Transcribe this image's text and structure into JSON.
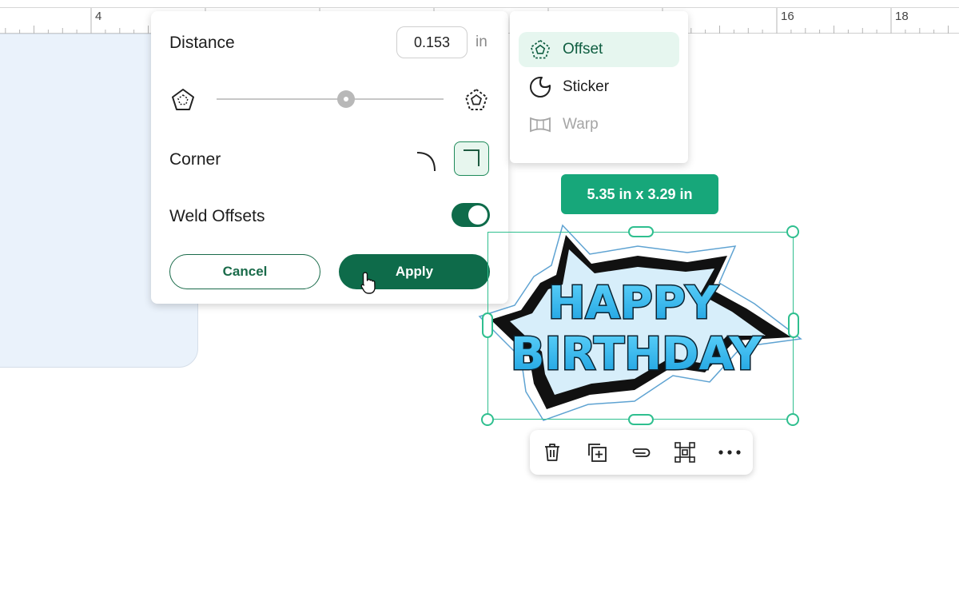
{
  "ruler": {
    "labels": [
      "4",
      "16",
      "18"
    ]
  },
  "offset_panel": {
    "distance_label": "Distance",
    "distance_value": "0.153",
    "distance_unit": "in",
    "slider_level_percent": 57,
    "corner_label": "Corner",
    "corner_selected": "square",
    "weld_label": "Weld Offsets",
    "weld_enabled": true,
    "cancel_label": "Cancel",
    "apply_label": "Apply"
  },
  "menu": {
    "items": [
      {
        "label": "Offset",
        "icon": "offset-icon",
        "selected": true
      },
      {
        "label": "Sticker",
        "icon": "sticker-icon",
        "selected": false
      },
      {
        "label": "Warp",
        "icon": "warp-icon",
        "disabled": true
      }
    ]
  },
  "selection": {
    "size_label": "5.35  in x 3.29  in"
  },
  "artwork": {
    "line1": "HAPPY",
    "line2": "BIRTHDAY"
  },
  "context_toolbar": {
    "icons": [
      "trash-icon",
      "duplicate-icon",
      "attach-icon",
      "group-icon",
      "more-icon"
    ]
  },
  "colors": {
    "accent": "#0e6b4a",
    "selection": "#2fbf8f",
    "badge": "#17a77a",
    "text_cyan": "#29b8ec",
    "mat": "#eaf2fb"
  }
}
